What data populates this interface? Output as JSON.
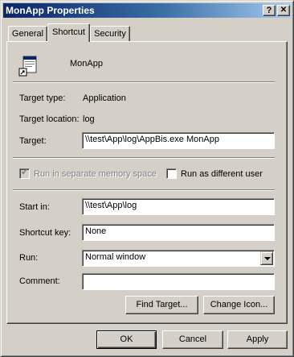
{
  "window": {
    "title": "MonApp Properties",
    "help_button": "?",
    "close_button": "X"
  },
  "tabs": [
    {
      "label": "General",
      "active": false
    },
    {
      "label": "Shortcut",
      "active": true
    },
    {
      "label": "Security",
      "active": false
    }
  ],
  "shortcut": {
    "icon": "shortcut-app-icon",
    "name": "MonApp",
    "target_type_label": "Target type:",
    "target_type_value": "Application",
    "target_location_label": "Target location:",
    "target_location_value": "log",
    "target_label": "Target:",
    "target_value": "\\\\test\\App\\log\\AppBis.exe MonApp",
    "run_separate_label": "Run in separate memory space",
    "run_separate_checked": true,
    "run_separate_enabled": false,
    "run_different_user_label": "Run as different user",
    "run_different_user_checked": false,
    "start_in_label": "Start in:",
    "start_in_value": "\\\\test\\App\\log",
    "shortcut_key_label": "Shortcut key:",
    "shortcut_key_value": "None",
    "run_label": "Run:",
    "run_value": "Normal window",
    "comment_label": "Comment:",
    "comment_value": "",
    "find_target_button": "Find Target...",
    "change_icon_button": "Change Icon..."
  },
  "footer": {
    "ok_button": "OK",
    "cancel_button": "Cancel",
    "apply_button": "Apply"
  }
}
